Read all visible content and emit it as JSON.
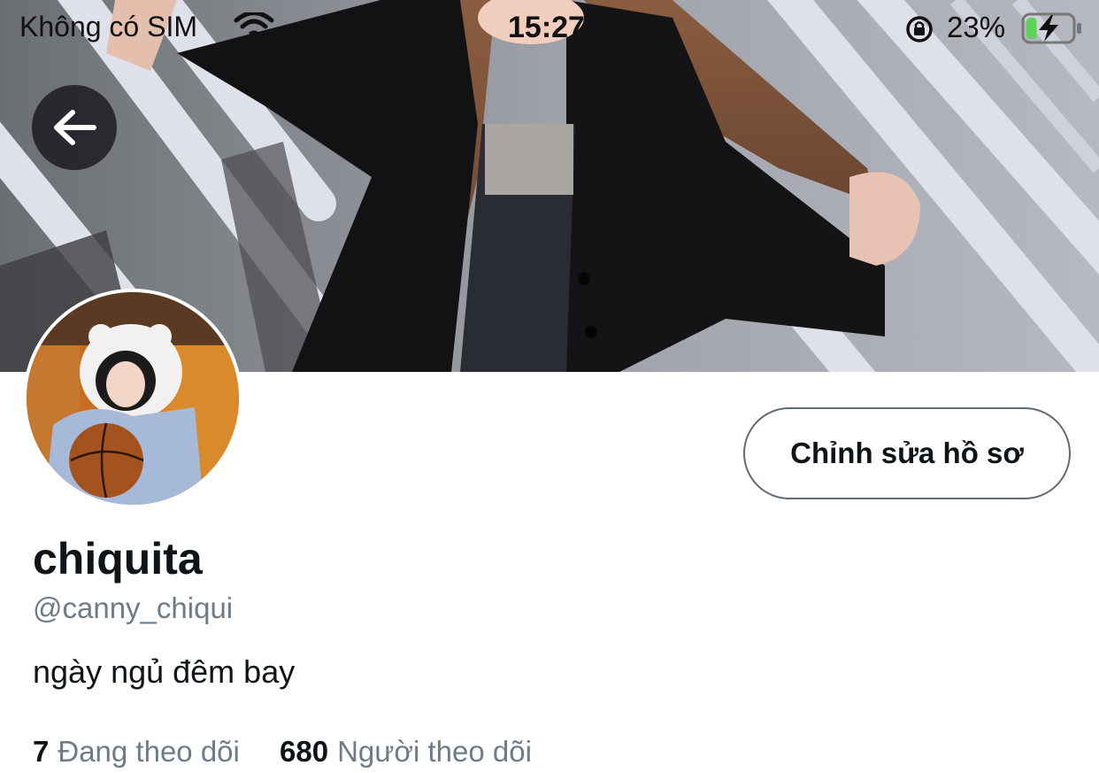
{
  "status_bar": {
    "carrier": "Không có SIM",
    "time": "15:27",
    "battery_percent": "23%",
    "battery_level": 0.23
  },
  "profile": {
    "display_name": "chiquita",
    "handle": "@canny_chiqui",
    "bio": "ngày ngủ đêm bay",
    "edit_button_label": "Chỉnh sửa hồ sơ",
    "following_count": "7",
    "following_label": "Đang theo dõi",
    "followers_count": "680",
    "followers_label": "Người theo dõi"
  },
  "icons": {
    "back": "arrow-left-icon",
    "wifi": "wifi-icon",
    "rotation_lock": "rotation-lock-icon",
    "battery": "battery-charging-icon"
  },
  "colors": {
    "text_primary": "#0f1419",
    "text_secondary": "#6e7b88",
    "button_border": "#5f6b78",
    "battery_fill": "#5dd35a"
  }
}
